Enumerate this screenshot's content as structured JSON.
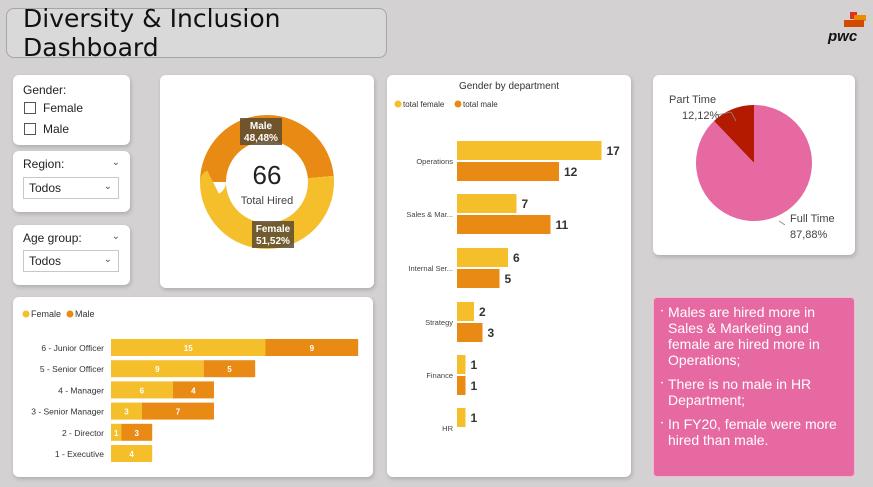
{
  "header": {
    "title": "Diversity & Inclusion Dashboard",
    "logo_text": "pwc"
  },
  "filters": {
    "gender": {
      "label": "Gender:",
      "options": [
        "Female",
        "Male"
      ]
    },
    "region": {
      "label": "Region:",
      "value": "Todos"
    },
    "age_group": {
      "label": "Age group:",
      "value": "Todos"
    }
  },
  "kpi": {
    "total": "66",
    "total_label": "Total Hired",
    "male_label": "Male",
    "male_pct": "48,48%",
    "female_label": "Female",
    "female_pct": "51,52%"
  },
  "colors": {
    "female": "#f4bf2a",
    "male": "#e88a13",
    "pink": "#e669a2",
    "dark_red": "#b31a00"
  },
  "chart_data": [
    {
      "type": "pie",
      "variant": "donut",
      "slices": [
        {
          "name": "Male",
          "value": 48.48
        },
        {
          "name": "Female",
          "value": 51.52
        }
      ],
      "center_value": 66
    },
    {
      "type": "bar",
      "orientation": "horizontal",
      "title": "Gender by department",
      "legend": [
        "total female",
        "total male"
      ],
      "categories": [
        "Operations",
        "Sales & Mar...",
        "Internal Ser...",
        "Strategy",
        "Finance",
        "HR"
      ],
      "series": [
        {
          "name": "total female",
          "values": [
            17,
            7,
            6,
            2,
            1,
            1
          ]
        },
        {
          "name": "total male",
          "values": [
            12,
            11,
            5,
            3,
            1,
            null
          ]
        }
      ]
    },
    {
      "type": "pie",
      "slices": [
        {
          "name": "Part Time",
          "value": 12.12,
          "label": "12,12%"
        },
        {
          "name": "Full Time",
          "value": 87.88,
          "label": "87,88%"
        }
      ]
    },
    {
      "type": "bar",
      "orientation": "horizontal",
      "stacked": true,
      "legend": [
        "Female",
        "Male"
      ],
      "categories": [
        "6 - Junior Officer",
        "5 - Senior Officer",
        "4 - Manager",
        "3 - Senior Manager",
        "2 - Director",
        "1 - Executive"
      ],
      "series": [
        {
          "name": "Female",
          "values": [
            15,
            9,
            6,
            3,
            1,
            4
          ]
        },
        {
          "name": "Male",
          "values": [
            9,
            5,
            4,
            7,
            3,
            null
          ]
        }
      ]
    }
  ],
  "insights": [
    "Males are hired more in Sales & Marketing and female are hired more in Operations;",
    "There is no male in HR Department;",
    "In FY20, female were more hired than male."
  ]
}
